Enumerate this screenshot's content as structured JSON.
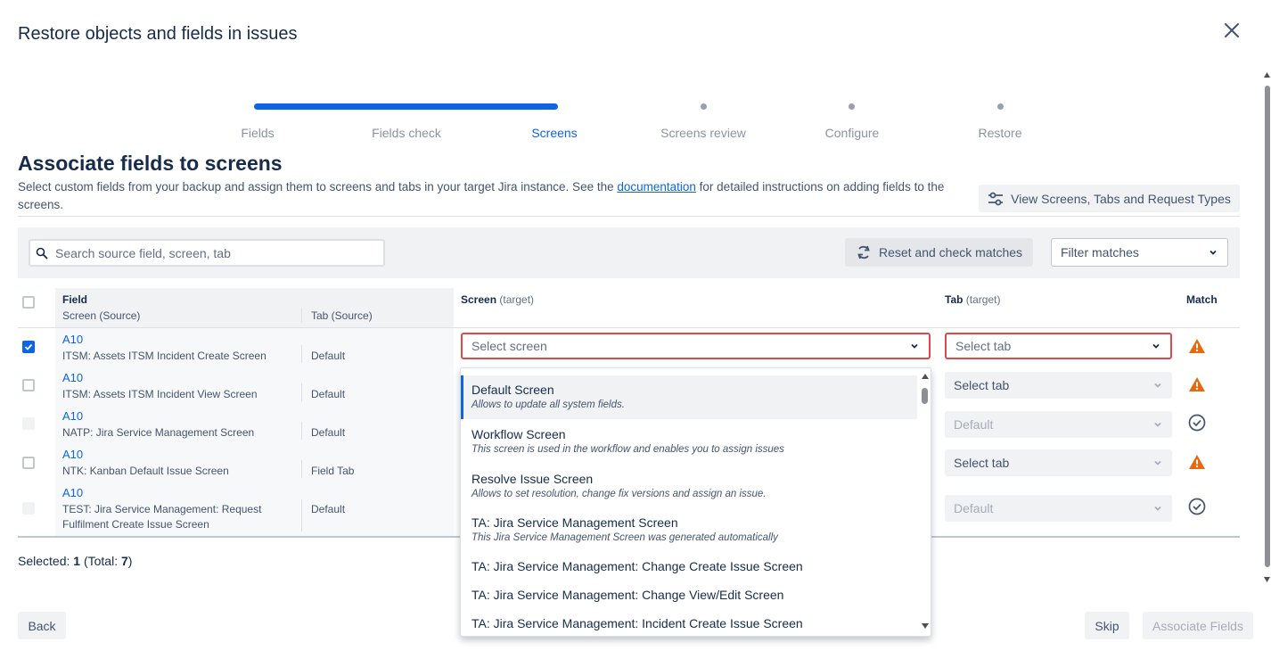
{
  "dialog": {
    "title": "Restore objects and fields in issues"
  },
  "stepper": {
    "steps": [
      {
        "label": "Fields",
        "state": "done"
      },
      {
        "label": "Fields check",
        "state": "done"
      },
      {
        "label": "Screens",
        "state": "active"
      },
      {
        "label": "Screens review",
        "state": "pending"
      },
      {
        "label": "Configure",
        "state": "pending"
      },
      {
        "label": "Restore",
        "state": "pending"
      }
    ]
  },
  "section": {
    "title": "Associate fields to screens",
    "desc_before": "Select custom fields from your backup and assign them to screens and tabs in your target Jira instance. See the ",
    "desc_link": "documentation",
    "desc_after": " for detailed instructions on adding fields to the screens."
  },
  "toolbar": {
    "view_button": "View Screens, Tabs and Request Types",
    "search_placeholder": "Search source field, screen, tab",
    "reset_button": "Reset and check matches",
    "filter_label": "Filter matches"
  },
  "table": {
    "headers": {
      "field": "Field",
      "screen_source": "Screen (Source)",
      "tab_source": "Tab (Source)",
      "screen_target": "Screen",
      "screen_target_note": "(target)",
      "tab_target": "Tab",
      "tab_target_note": "(target)",
      "match": "Match"
    },
    "rows": [
      {
        "field": "A10",
        "screen": "ITSM: Assets ITSM Incident Create Screen",
        "tab": "Default",
        "checked": true,
        "tab_target": "Select tab",
        "match": "warning"
      },
      {
        "field": "A10",
        "screen": "ITSM: Assets ITSM Incident View Screen",
        "tab": "Default",
        "checked": false,
        "tab_target": "Select tab",
        "match": "warning"
      },
      {
        "field": "A10",
        "screen": "NATP: Jira Service Management Screen",
        "tab": "Default",
        "checked": false,
        "tab_target": "Default",
        "match": "ok"
      },
      {
        "field": "A10",
        "screen": "NTK: Kanban Default Issue Screen",
        "tab": "Field Tab",
        "checked": false,
        "tab_target": "Select tab",
        "match": "warning"
      },
      {
        "field": "A10",
        "screen": "TEST: Jira Service Management: Request Fulfilment Create Issue Screen",
        "tab": "Default",
        "checked": false,
        "tab_target": "Default",
        "match": "ok"
      }
    ],
    "select_screen_placeholder": "Select screen"
  },
  "dropdown": {
    "items": [
      {
        "label": "Default Screen",
        "desc": "Allows to update all system fields."
      },
      {
        "label": "Workflow Screen",
        "desc": "This screen is used in the workflow and enables you to assign issues"
      },
      {
        "label": "Resolve Issue Screen",
        "desc": "Allows to set resolution, change fix versions and assign an issue."
      },
      {
        "label": "TA: Jira Service Management Screen",
        "desc": "This Jira Service Management Screen was generated automatically"
      },
      {
        "label": "TA: Jira Service Management: Change Create Issue Screen",
        "desc": ""
      },
      {
        "label": "TA: Jira Service Management: Change View/Edit Screen",
        "desc": ""
      },
      {
        "label": "TA: Jira Service Management: Incident Create Issue Screen",
        "desc": ""
      }
    ]
  },
  "footer": {
    "selected_label": "Selected:",
    "selected_count": "1",
    "total_label": "(Total:",
    "total_count": "7",
    "total_close": ")",
    "back": "Back",
    "skip": "Skip",
    "associate": "Associate Fields"
  },
  "colors": {
    "accent": "#0c66e4",
    "warning": "#e56910",
    "error_border": "#e0474b"
  }
}
